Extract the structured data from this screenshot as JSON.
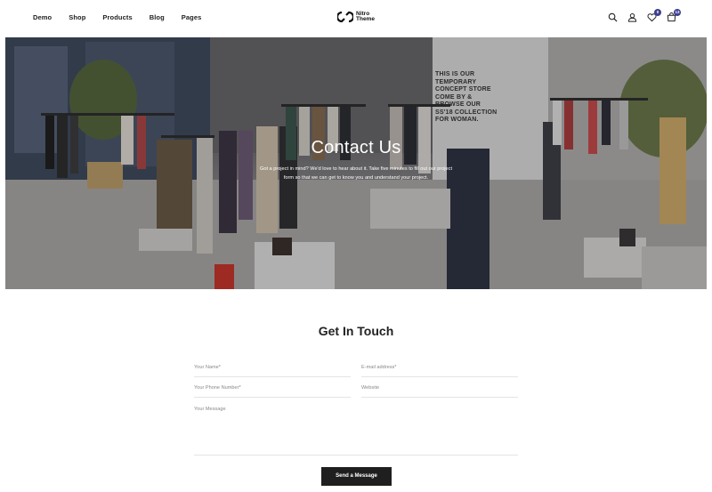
{
  "nav": {
    "items": [
      {
        "label": "Demo"
      },
      {
        "label": "Shop"
      },
      {
        "label": "Products"
      },
      {
        "label": "Blog"
      },
      {
        "label": "Pages"
      }
    ]
  },
  "logo": {
    "line1": "Nitro",
    "line2": "Theme"
  },
  "header_icons": {
    "search": "search-icon",
    "account": "user-icon",
    "wishlist": "heart-icon",
    "wishlist_count": "0",
    "cart": "cart-icon",
    "cart_count": "13"
  },
  "hero": {
    "title": "Contact Us",
    "text": "Got a project in mind? We'd love to hear about it. Take five minutes to fill out our project form so that we can get to know you and understand your project.",
    "wall_sign": "THIS IS OUR TEMPORARY CONCEPT STORE COME BY & BROWSE OUR SS'18 COLLECTION FOR WOMAN."
  },
  "contact": {
    "title": "Get In Touch",
    "name_placeholder": "Your Name*",
    "email_placeholder": "E-mail address*",
    "phone_placeholder": "Your Phone Number*",
    "website_placeholder": "Website",
    "message_placeholder": "Your Message",
    "submit_label": "Send a Message"
  },
  "colors": {
    "accent": "#3c3f8f",
    "button": "#1f1f1f"
  }
}
